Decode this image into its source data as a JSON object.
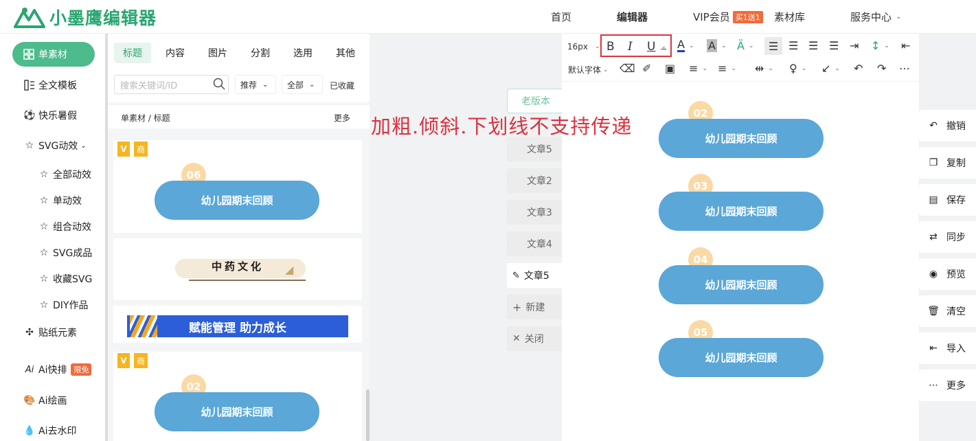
{
  "header": {
    "logo_text": "小墨鹰编辑器",
    "nav": [
      "首页",
      "编辑器",
      "VIP会员",
      "素材库",
      "服务中心"
    ],
    "vip_badge": "买1送1"
  },
  "sidebar": {
    "active": "单素材",
    "items": [
      "全文模板",
      "快乐暑假",
      "SVG动效",
      "全部动效",
      "单动效",
      "组合动效",
      "SVG成品",
      "收藏SVG",
      "DIY作品",
      "贴纸元素",
      "Ai快排",
      "Ai绘画",
      "Ai去水印"
    ],
    "free_tag": "限免"
  },
  "panel": {
    "tabs": [
      "标题",
      "内容",
      "图片",
      "分割",
      "选用",
      "其他"
    ],
    "search_placeholder": "搜索关键词/ID",
    "sort": "推荐",
    "filter": "全部",
    "collected": "已收藏",
    "breadcrumb": "单素材 / 标题",
    "more": "更多",
    "cards": [
      {
        "badge_v": "V",
        "badge_shang": "商",
        "num": "06",
        "title": "幼儿园期末回顾"
      },
      {
        "title": "中药文化"
      },
      {
        "title": "赋能管理 助力成长"
      },
      {
        "badge_v": "V",
        "badge_shang": "商",
        "num": "02",
        "title": "幼儿园期末回顾"
      }
    ]
  },
  "workspace": {
    "old_version": "老版本",
    "articles": [
      "文章5",
      "文章2",
      "文章3",
      "文章4",
      "文章5"
    ],
    "new_label": "新建",
    "close_label": "关闭"
  },
  "toolbar": {
    "font_size": "16px",
    "font_family": "默认字体"
  },
  "annotation": "加粗.倾斜.下划线不支持传递",
  "editor_banners": [
    {
      "num": "02",
      "title": "幼儿园期末回顾"
    },
    {
      "num": "03",
      "title": "幼儿园期末回顾"
    },
    {
      "num": "04",
      "title": "幼儿园期末回顾"
    },
    {
      "num": "05",
      "title": "幼儿园期末回顾"
    }
  ],
  "actions": [
    "撤销",
    "复制",
    "保存",
    "同步",
    "预览",
    "清空",
    "导入",
    "更多"
  ],
  "colors": {
    "brand": "#29a670",
    "active": "#4dbb8c",
    "banner": "#5aa7d8",
    "annotation": "#d9333f"
  }
}
